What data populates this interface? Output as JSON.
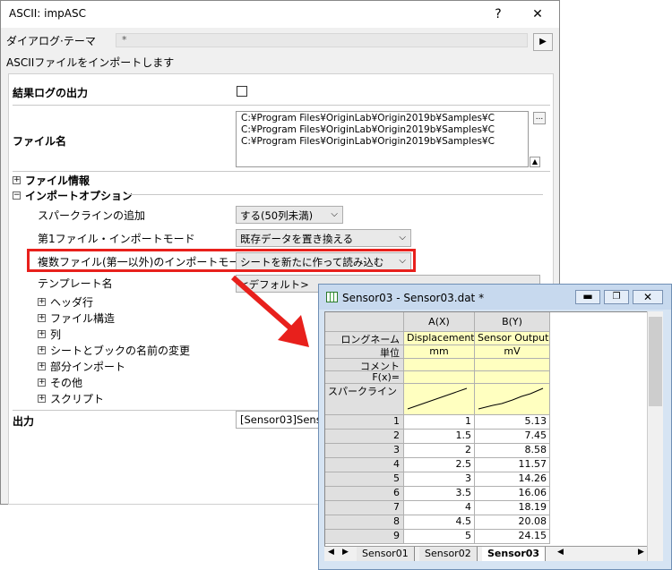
{
  "dialog": {
    "title": "ASCII: impASC",
    "help_btn": "?",
    "close_btn": "✕",
    "theme_label": "ダイアログ·テーマ",
    "theme_value": "*",
    "theme_btn": "▶",
    "description": "ASCIIファイルをインポートします",
    "result_log_label": "結果ログの出力",
    "file_name_label": "ファイル名",
    "files": [
      "C:¥Program Files¥OriginLab¥Origin2019b¥Samples¥C",
      "C:¥Program Files¥OriginLab¥Origin2019b¥Samples¥C",
      "C:¥Program Files¥OriginLab¥Origin2019b¥Samples¥C"
    ],
    "browse_btn": "...",
    "file_info": "ファイル情報",
    "import_options": "インポートオプション",
    "sparkline_label": "スパークラインの追加",
    "sparkline_value": "する(50列未満)",
    "first_mode_label": "第1ファイル・インポートモード",
    "first_mode_value": "既存データを置き換える",
    "multi_mode_label": "複数ファイル(第一以外)のインポートモード",
    "multi_mode_value": "シートを新たに作って読み込む",
    "template_label": "テンプレート名",
    "template_value": "<デフォルト>",
    "sub_items": [
      "ヘッダ行",
      "ファイル構造",
      "列",
      "シートとブックの名前の変更",
      "部分インポート",
      "その他",
      "スクリプト"
    ],
    "output_label": "出力",
    "output_value": "[Sensor03]Sens"
  },
  "worksheet": {
    "title": "Sensor03 - Sensor03.dat *",
    "columns": [
      "A(X)",
      "B(Y)"
    ],
    "row_labels": [
      "ロングネーム",
      "単位",
      "コメント",
      "F(x)=",
      "スパークライン"
    ],
    "long_names": [
      "Displacement",
      "Sensor Output"
    ],
    "units": [
      "mm",
      "mV"
    ],
    "rows": [
      [
        "1",
        "1",
        "5.13"
      ],
      [
        "2",
        "1.5",
        "7.45"
      ],
      [
        "3",
        "2",
        "8.58"
      ],
      [
        "4",
        "2.5",
        "11.57"
      ],
      [
        "5",
        "3",
        "14.26"
      ],
      [
        "6",
        "3.5",
        "16.06"
      ],
      [
        "7",
        "4",
        "18.19"
      ],
      [
        "8",
        "4.5",
        "20.08"
      ],
      [
        "9",
        "5",
        "24.15"
      ]
    ],
    "tabs": [
      "Sensor01",
      "Sensor02",
      "Sensor03"
    ]
  },
  "colors": {
    "highlight": "#e8201c",
    "yellow_cell": "#ffffc0",
    "window_frame": "#d6e4f3"
  }
}
